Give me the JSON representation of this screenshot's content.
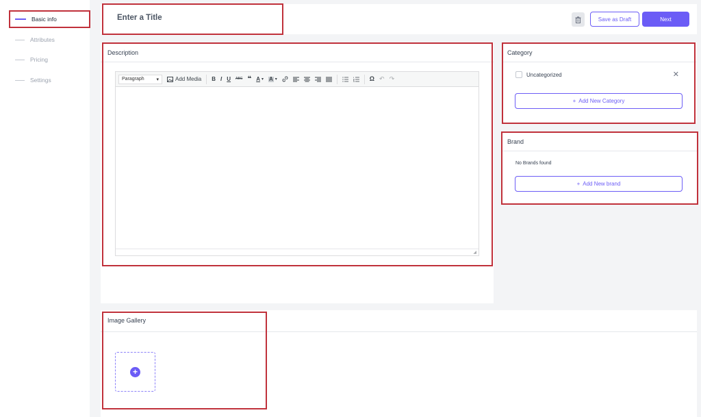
{
  "sidebar": {
    "items": [
      {
        "label": "Basic info"
      },
      {
        "label": "Attributes"
      },
      {
        "label": "Pricing"
      },
      {
        "label": "Settings"
      }
    ]
  },
  "header": {
    "title_placeholder": "Enter a Title",
    "save_draft_label": "Save as Draft",
    "next_label": "Next",
    "accent_color": "#6b5cf6"
  },
  "description": {
    "title": "Description",
    "toolbar": {
      "paragraph_label": "Paragraph",
      "add_media_label": "Add Media"
    }
  },
  "category": {
    "title": "Category",
    "items": [
      {
        "label": "Uncategorized"
      }
    ],
    "add_label": "Add New Category"
  },
  "brand": {
    "title": "Brand",
    "empty_text": "No Brands found",
    "add_label": "Add New brand"
  },
  "gallery": {
    "title": "Image Gallery"
  }
}
